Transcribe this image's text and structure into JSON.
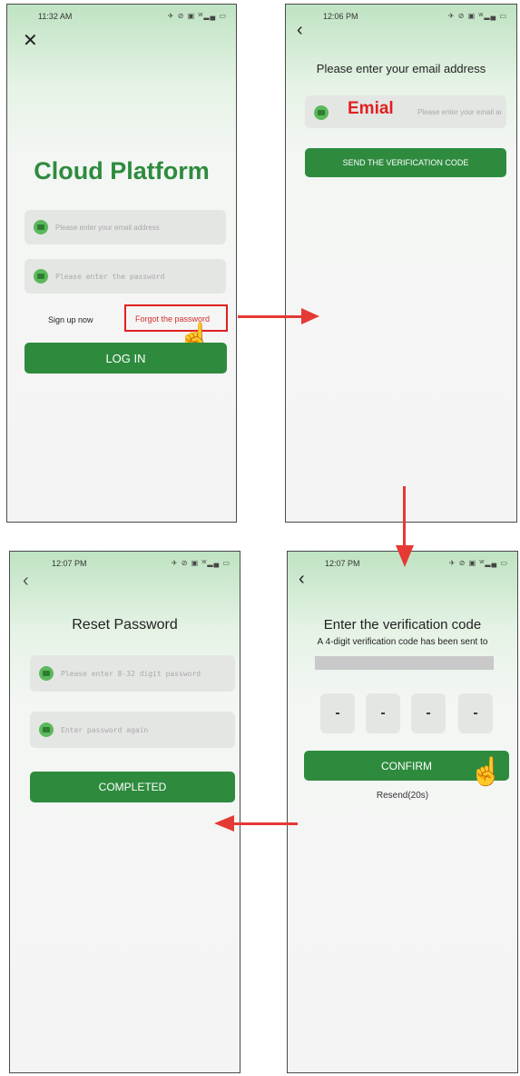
{
  "screen_login": {
    "time": "11:32 AM",
    "status_icons": "✈ ⊘ ▣ ᵂ▂▄ ▭",
    "title": "Cloud Platform",
    "email_placeholder": "Please enter your email address",
    "password_placeholder": "Please enter the password",
    "signup_label": "Sign up now",
    "forgot_label": "Forgot the password",
    "login_label": "LOG IN"
  },
  "screen_email": {
    "time": "12:06 PM",
    "status_icons": "✈ ⊘ ▣ ᵂ▂▄ ▭",
    "heading": "Please enter your email address",
    "overlay_label": "Emial",
    "email_placeholder": "Please enter your email address",
    "send_label": "SEND THE VERIFICATION CODE"
  },
  "screen_reset": {
    "time": "12:07 PM",
    "status_icons": "✈ ⊘ ▣ ᵂ▂▄ ▭",
    "heading": "Reset Password",
    "password_placeholder": "Please enter 8-32 digit password",
    "confirm_placeholder": "Enter password again",
    "completed_label": "COMPLETED"
  },
  "screen_verify": {
    "time": "12:07 PM",
    "status_icons": "✈ ⊘ ▣ ᵂ▂▄ ▭",
    "heading": "Enter the verification code",
    "subtext": "A 4-digit verification code has been sent to",
    "digits": [
      "-",
      "-",
      "-",
      "-"
    ],
    "confirm_label": "CONFIRM",
    "resend_label": "Resend(20s)"
  },
  "colors": {
    "brand_green": "#2e8b3e",
    "annotation_red": "#e53935"
  }
}
